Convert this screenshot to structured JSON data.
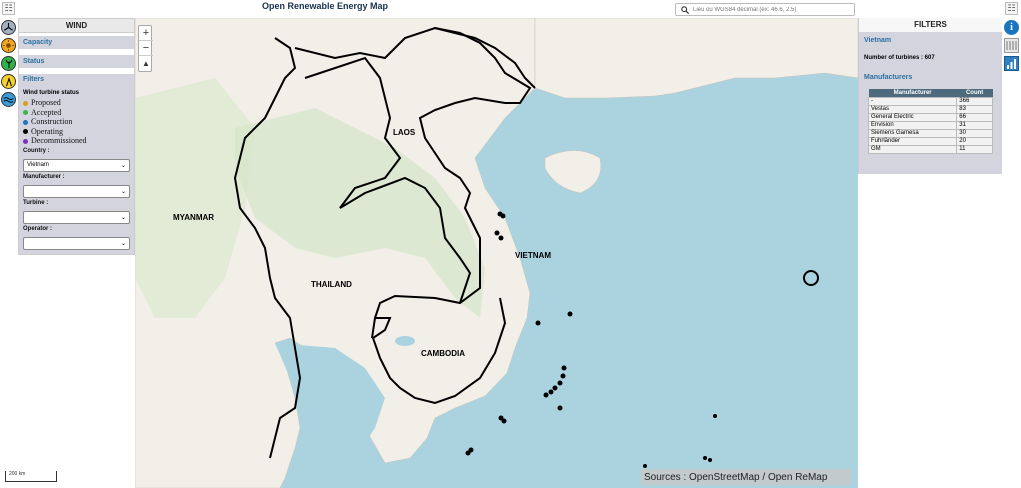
{
  "header": {
    "title": "Open Renewable Energy Map",
    "search_placeholder": "Lieu ou WGS84 décimal (ex: 46.6, 2.5)",
    "menu_glyph": "☷"
  },
  "left_panel": {
    "title": "WIND",
    "sections": {
      "capacity": "Capacity",
      "status": "Status",
      "filters": "Filters"
    },
    "status_heading": "Wind turbine status",
    "statuses": [
      {
        "label": "Proposed",
        "color": "#d4a017"
      },
      {
        "label": "Accepted",
        "color": "#3cb54a"
      },
      {
        "label": "Construction",
        "color": "#1b75bc"
      },
      {
        "label": "Operating",
        "color": "#000000"
      },
      {
        "label": "Decommissioned",
        "color": "#7b2fbe"
      }
    ],
    "fields": {
      "country_label": "Country :",
      "country_value": "Vietnam",
      "manufacturer_label": "Manufacturer :",
      "manufacturer_value": "",
      "turbine_label": "Turbine :",
      "turbine_value": "",
      "operator_label": "Operator :",
      "operator_value": ""
    }
  },
  "map": {
    "zoom_in": "+",
    "zoom_out": "−",
    "compass": "▲",
    "sources": "Sources : OpenStreetMap / Open ReMap",
    "scale": "200 km",
    "country_labels": {
      "myanmar": "MYANMAR",
      "laos": "LAOS",
      "thailand": "THAILAND",
      "vietnam": "VIETNAM",
      "cambodia": "CAMBODIA"
    }
  },
  "right_panel": {
    "title": "FILTERS",
    "country": "Vietnam",
    "turbines_text": "Number of turbines : 607",
    "manufacturers_heading": "Manufacturers",
    "table": {
      "headers": [
        "Manufacturer",
        "Count"
      ],
      "rows": [
        [
          "-",
          "366"
        ],
        [
          "Vestas",
          "83"
        ],
        [
          "General Electric",
          "66"
        ],
        [
          "Envision",
          "31"
        ],
        [
          "Siemens Gamesa",
          "30"
        ],
        [
          "Fuhrländer",
          "20"
        ],
        [
          "GM",
          "11"
        ]
      ]
    }
  },
  "colors": {
    "accent": "#2c6fa0",
    "panel_bg": "#d3d4de",
    "sea": "#aad3df",
    "land": "#f2efe9"
  }
}
